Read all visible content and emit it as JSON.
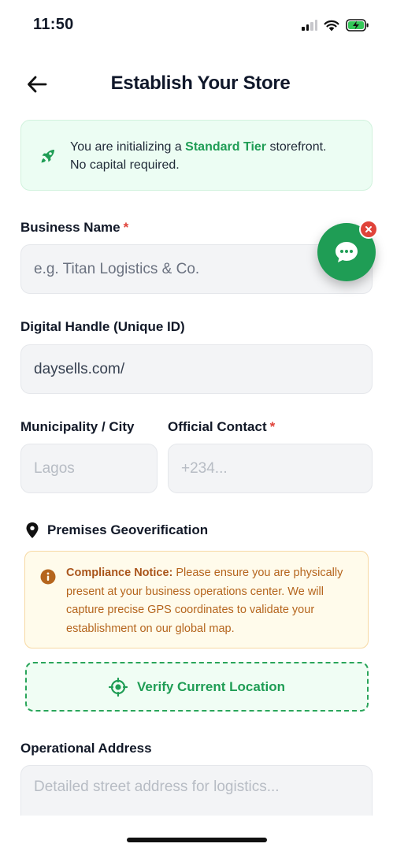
{
  "status_bar": {
    "time": "11:50"
  },
  "header": {
    "title": "Establish Your Store",
    "back_icon": "arrow-left-icon"
  },
  "tier_banner": {
    "prefix": "You are initializing a ",
    "tier": "Standard Tier",
    "suffix": " storefront.",
    "line2": "No capital required.",
    "icon": "rocket-icon",
    "accent_color": "#1f9d55"
  },
  "form": {
    "business_name": {
      "label": "Business Name",
      "required_mark": "*",
      "placeholder": "e.g. Titan Logistics & Co."
    },
    "digital_handle": {
      "label": "Digital Handle (Unique ID)",
      "value": "daysells.com/"
    },
    "city": {
      "label": "Municipality / City",
      "placeholder": "Lagos"
    },
    "contact": {
      "label": "Official Contact",
      "required_mark": "*",
      "placeholder": "+234..."
    },
    "address": {
      "label": "Operational Address",
      "placeholder": "Detailed street address for logistics..."
    }
  },
  "geoverification": {
    "heading": "Premises Geoverification",
    "icon": "map-pin-icon",
    "notice_title": "Compliance Notice:",
    "notice_body": " Please ensure you are physically present at your business operations center. We will capture precise GPS coordinates to validate your establishment on our global map.",
    "verify_label": "Verify Current Location",
    "verify_icon": "crosshair-icon"
  },
  "chat": {
    "icon": "chat-bubble-icon",
    "close_icon": "close-icon"
  },
  "colors": {
    "brand_green": "#1f9d55",
    "required_red": "#e0433a",
    "notice_amber": "#b5651d"
  }
}
